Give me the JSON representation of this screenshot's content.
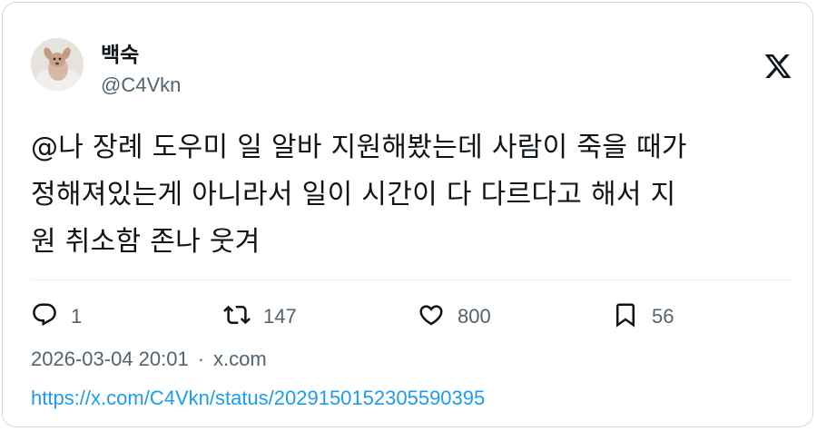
{
  "tweet": {
    "author_name": "백숙",
    "author_handle": "@C4Vkn",
    "text": "@나 장례 도우미 일 알바 지원해봤는데 사람이 죽을 때가\n정해져있는게 아니라서 일이 시간이 다 다르다고 해서 지\n원 취소함 존나 웃겨",
    "timestamp": "2026-03-04 20:01",
    "separator": "·",
    "source": "x.com",
    "url": "https://x.com/C4Vkn/status/2029150152305590395"
  },
  "actions": {
    "reply_count": "1",
    "retweet_count": "147",
    "like_count": "800",
    "bookmark_count": "56"
  },
  "icons": {
    "brand_logo": "x-logo-icon",
    "reply": "reply-icon",
    "retweet": "retweet-icon",
    "like": "heart-icon",
    "bookmark": "bookmark-icon"
  },
  "colors": {
    "text_primary": "#0f1419",
    "text_secondary": "#536471",
    "link": "#1d9bf0",
    "border": "#cfd9de"
  }
}
